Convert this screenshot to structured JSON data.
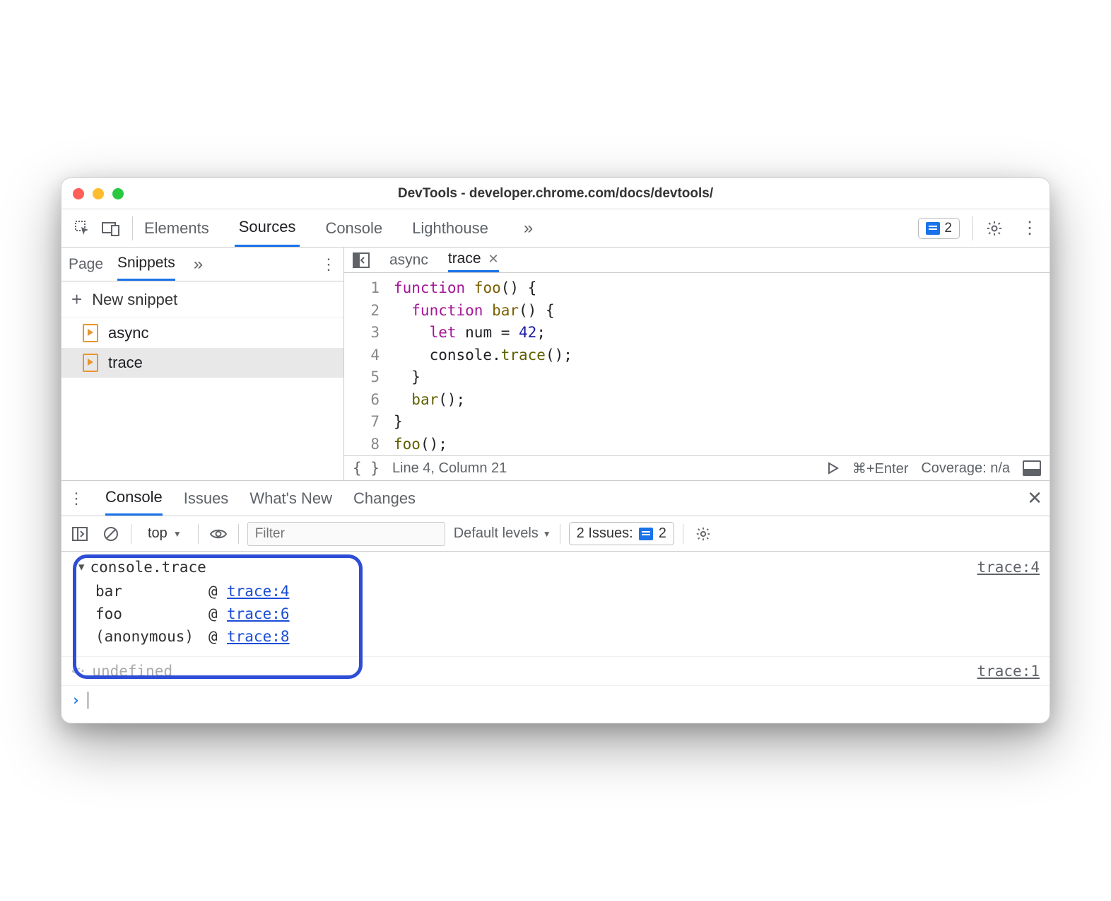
{
  "window": {
    "title": "DevTools - developer.chrome.com/docs/devtools/"
  },
  "mainTabs": {
    "items": [
      "Elements",
      "Sources",
      "Console",
      "Lighthouse"
    ],
    "activeIndex": 1,
    "issuesCount": "2"
  },
  "sidebar": {
    "tabs": [
      "Page",
      "Snippets"
    ],
    "activeIndex": 1,
    "newSnippet": "New snippet",
    "snippets": [
      "async",
      "trace"
    ],
    "selectedIndex": 1
  },
  "editor": {
    "tabs": [
      {
        "name": "async",
        "active": false,
        "closable": false
      },
      {
        "name": "trace",
        "active": true,
        "closable": true
      }
    ],
    "lineNumbers": [
      "1",
      "2",
      "3",
      "4",
      "5",
      "6",
      "7",
      "8"
    ],
    "code": {
      "l1a": "function",
      "l1b": " foo",
      "l1c": "() {",
      "l2a": "  function",
      "l2b": " bar",
      "l2c": "() {",
      "l3a": "    let",
      "l3b": " num = ",
      "l3c": "42",
      "l3d": ";",
      "l4a": "    console.",
      "l4b": "trace",
      "l4c": "();",
      "l5": "  }",
      "l6a": "  ",
      "l6b": "bar",
      "l6c": "();",
      "l7": "}",
      "l8a": "",
      "l8b": "foo",
      "l8c": "();"
    },
    "status": {
      "cursor": "Line 4, Column 21",
      "runHint": "⌘+Enter",
      "coverage": "Coverage: n/a"
    }
  },
  "drawer": {
    "tabs": [
      "Console",
      "Issues",
      "What's New",
      "Changes"
    ],
    "activeIndex": 0
  },
  "consoleToolbar": {
    "context": "top",
    "filterPlaceholder": "Filter",
    "levels": "Default levels",
    "issuesLabel": "2 Issues:",
    "issuesCount": "2"
  },
  "consoleOutput": {
    "traceTitle": "console.trace",
    "traceSource": "trace:4",
    "stack": [
      {
        "fn": "bar",
        "loc": "trace:4"
      },
      {
        "fn": "foo",
        "loc": "trace:6"
      },
      {
        "fn": "(anonymous)",
        "loc": "trace:8"
      }
    ],
    "returnValue": "undefined",
    "returnSource": "trace:1"
  }
}
